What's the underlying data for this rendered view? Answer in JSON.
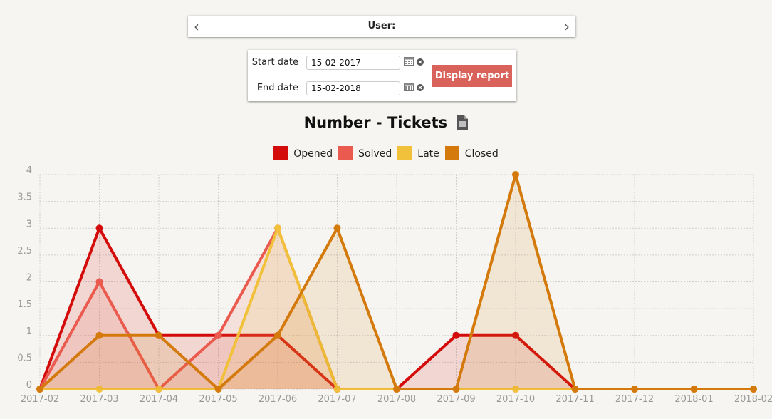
{
  "header": {
    "prev_icon": "chevron-left-icon",
    "next_icon": "chevron-right-icon",
    "user_label": "User:",
    "user_value": ""
  },
  "form": {
    "start_label": "Start date",
    "start_value": "15-02-2017",
    "end_label": "End date",
    "end_value": "15-02-2018",
    "calendar_icon": "calendar-icon",
    "clear_icon": "clear-icon",
    "submit_label": "Display report",
    "submit_color": "#d9635a"
  },
  "chart_data": {
    "type": "area",
    "title": "Number - Tickets",
    "title_icon": "document-icon",
    "xlabel": "",
    "ylabel": "",
    "ylim": [
      0,
      4
    ],
    "yticks": [
      "0",
      "0.5",
      "1",
      "1.5",
      "2",
      "2.5",
      "3",
      "3.5",
      "4"
    ],
    "categories": [
      "2017-02",
      "2017-03",
      "2017-04",
      "2017-05",
      "2017-06",
      "2017-07",
      "2017-08",
      "2017-09",
      "2017-10",
      "2017-11",
      "2017-12",
      "2018-01",
      "2018-02"
    ],
    "grid": true,
    "legend_position": "top-center",
    "series": [
      {
        "name": "Opened",
        "color": "#d40b0b",
        "values": [
          0,
          3,
          1,
          1,
          1,
          0,
          0,
          1,
          1,
          0,
          0,
          0,
          0
        ]
      },
      {
        "name": "Solved",
        "color": "#eb5a4e",
        "values": [
          0,
          2,
          0,
          1,
          3,
          0,
          0,
          0,
          0,
          0,
          0,
          0,
          0
        ]
      },
      {
        "name": "Late",
        "color": "#f2c13c",
        "values": [
          0,
          0,
          0,
          0,
          3,
          0,
          0,
          0,
          0,
          0,
          0,
          0,
          0
        ]
      },
      {
        "name": "Closed",
        "color": "#d47a0c",
        "values": [
          0,
          1,
          1,
          0,
          1,
          3,
          0,
          0,
          4,
          0,
          0,
          0,
          0
        ]
      }
    ]
  }
}
